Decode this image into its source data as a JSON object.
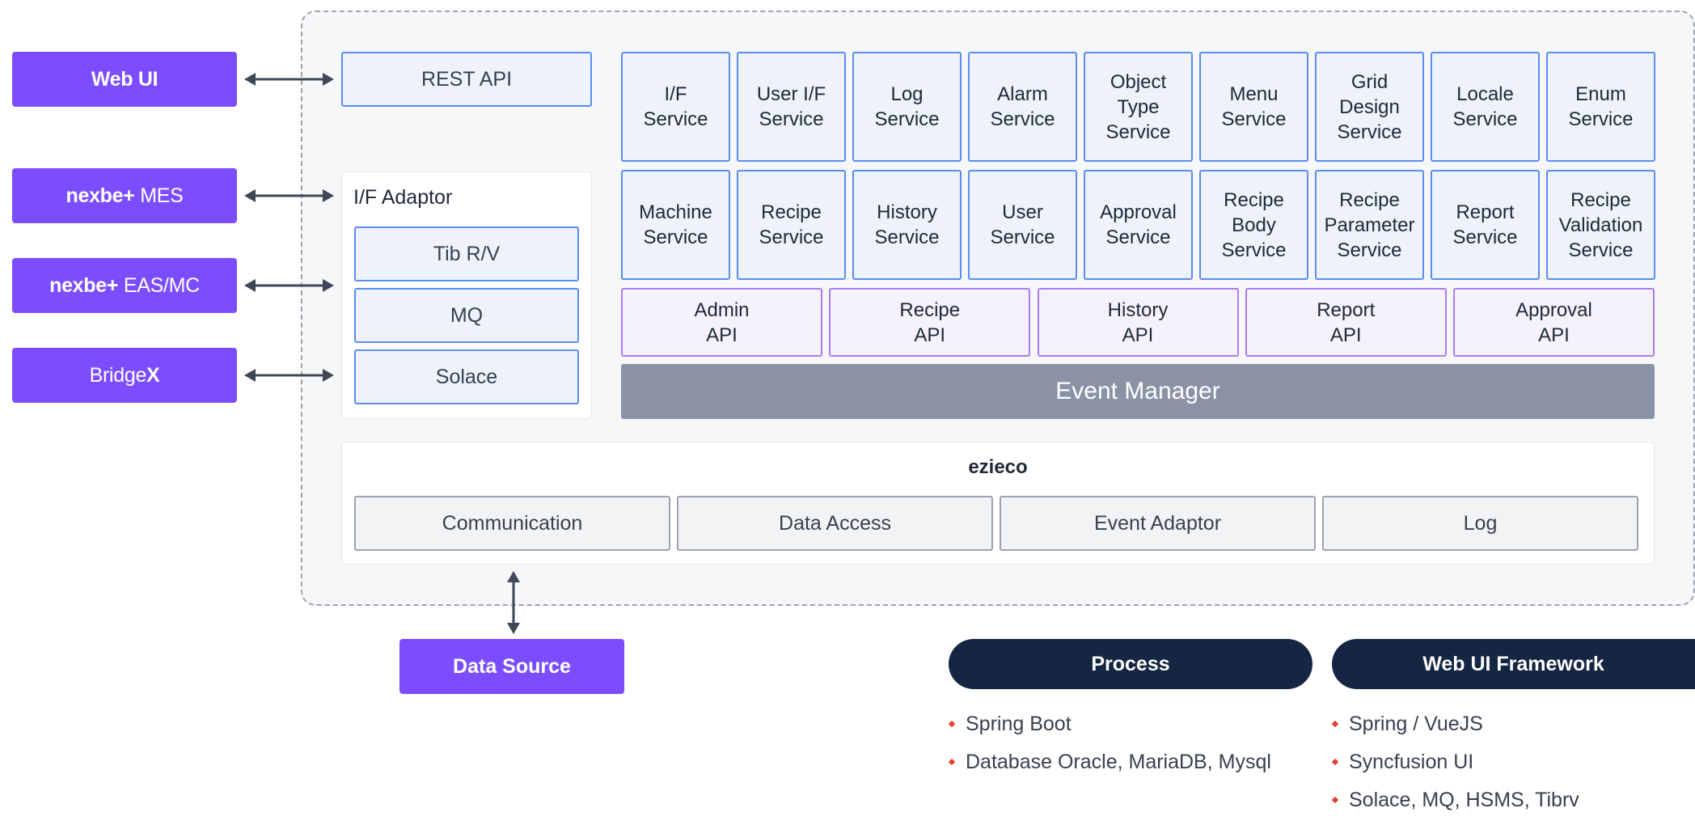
{
  "external": {
    "web_ui": "Web UI",
    "mes_bold": "nexbe+",
    "mes_rest": " MES",
    "eas_bold": "nexbe+",
    "eas_rest": " EAS/MC",
    "bridge_a": "Bridge",
    "bridge_b": "X"
  },
  "rest_api": "REST API",
  "if_adaptor": {
    "title": "I/F Adaptor",
    "items": [
      "Tib R/V",
      "MQ",
      "Solace"
    ]
  },
  "services": {
    "row1": [
      [
        "I/F",
        "Service"
      ],
      [
        "User I/F",
        "Service"
      ],
      [
        "Log",
        "Service"
      ],
      [
        "Alarm",
        "Service"
      ],
      [
        "Object",
        "Type",
        "Service"
      ],
      [
        "Menu",
        "Service"
      ],
      [
        "Grid",
        "Design",
        "Service"
      ],
      [
        "Locale",
        "Service"
      ],
      [
        "Enum",
        "Service"
      ]
    ],
    "row2": [
      [
        "Machine",
        "Service"
      ],
      [
        "Recipe",
        "Service"
      ],
      [
        "History",
        "Service"
      ],
      [
        "User",
        "Service"
      ],
      [
        "Approval",
        "Service"
      ],
      [
        "Recipe",
        "Body",
        "Service"
      ],
      [
        "Recipe",
        "Parameter",
        "Service"
      ],
      [
        "Report",
        "Service"
      ],
      [
        "Recipe",
        "Validation",
        "Service"
      ]
    ]
  },
  "apis": [
    [
      "Admin",
      "API"
    ],
    [
      "Recipe",
      "API"
    ],
    [
      "History",
      "API"
    ],
    [
      "Report",
      "API"
    ],
    [
      "Approval",
      "API"
    ]
  ],
  "event_manager": "Event Manager",
  "ezieco": {
    "title": "ezieco",
    "items": [
      "Communication",
      "Data Access",
      "Event Adaptor",
      "Log"
    ]
  },
  "data_source": "Data Source",
  "process": {
    "title": "Process",
    "items": [
      "Spring Boot",
      "Database Oracle, MariaDB, Mysql"
    ]
  },
  "web_ui_framework": {
    "title": "Web UI Framework",
    "items": [
      "Spring / VueJS",
      "Syncfusion UI",
      "Solace, MQ, HSMS, Tibrv"
    ]
  },
  "colors": {
    "external_purple": "#7c4dff",
    "service_blue_border": "#5b8def",
    "api_purple_border": "#a87df2",
    "event_manager_gray": "#8a93a6",
    "pill_navy": "#152642",
    "bullet_red": "#e8402f"
  }
}
